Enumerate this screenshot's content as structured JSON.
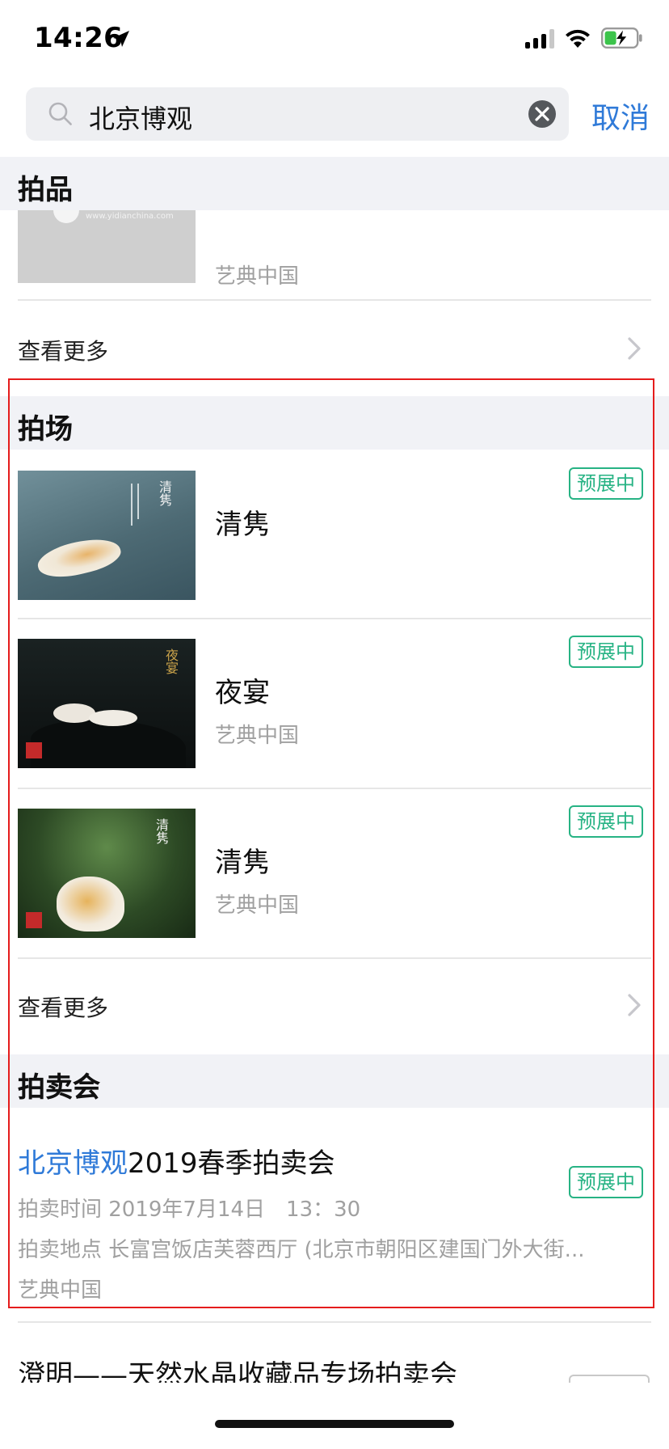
{
  "status_bar": {
    "time": "14:26"
  },
  "search": {
    "query": "北京博观",
    "cancel_label": "取消"
  },
  "lots_section": {
    "title": "拍品",
    "partial_item": {
      "subtitle": "艺典中国",
      "watermark": "www.yidianchina.com"
    },
    "more_label": "查看更多"
  },
  "sessions_section": {
    "title": "拍场",
    "items": [
      {
        "title": "清隽",
        "subtitle": "",
        "badge": "预展中",
        "art_text": "清隽"
      },
      {
        "title": "夜宴",
        "subtitle": "艺典中国",
        "badge": "预展中",
        "art_text": "夜宴"
      },
      {
        "title": "清隽",
        "subtitle": "艺典中国",
        "badge": "预展中",
        "art_text": "清隽"
      }
    ],
    "more_label": "查看更多"
  },
  "auctions_section": {
    "title": "拍卖会",
    "items": [
      {
        "title_highlight": "北京博观",
        "title_rest": "2019春季拍卖会",
        "time_line": "拍卖时间 2019年7月14日　13：30",
        "place_line": "拍卖地点 长富宫饭店芙蓉西厅 (北京市朝阳区建国门外大街...",
        "org": "艺典中国",
        "badge": "预展中"
      },
      {
        "title_full": "澄明——天然水晶收藏品专场拍卖会"
      }
    ]
  },
  "colors": {
    "accent": "#2f7ad8",
    "badge_green": "#27b384",
    "highlight_box": "#e51c1c"
  }
}
